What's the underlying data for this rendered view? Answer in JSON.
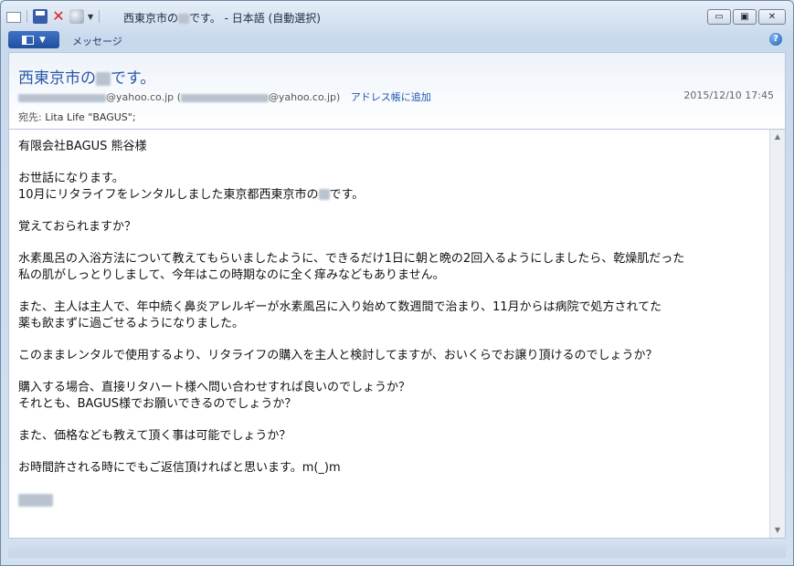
{
  "window": {
    "title_prefix": "西東京市の",
    "title_suffix": "です。 - 日本語 (自動選択)",
    "controls": {
      "minimize": "▭",
      "maximize": "▣",
      "close": "✕"
    }
  },
  "ribbon": {
    "tab_message": "メッセージ",
    "help": "?"
  },
  "header": {
    "subject_prefix": "西東京市の",
    "subject_suffix": "です。",
    "sender_domain": "@yahoo.co.jp",
    "sender_paren_open": "(",
    "sender_paren_domain": "@yahoo.co.jp)",
    "add_to_address_book": "アドレス帳に追加",
    "date": "2015/12/10 17:45",
    "to_label": "宛先:",
    "to_value": "Lita Life \"BAGUS\";"
  },
  "body": {
    "greeting": "有限会社BAGUS 熊谷様",
    "p1_line1": "お世話になります。",
    "p1_line2_prefix": "10月にリタライフをレンタルしました東京都西東京市の",
    "p1_line2_suffix": "です。",
    "p2": "覚えておられますか？",
    "p3_line1": "水素風呂の入浴方法について教えてもらいましたように、できるだけ1日に朝と晩の2回入るようにしましたら、乾燥肌だった",
    "p3_line2": "私の肌がしっとりしまして、今年はこの時期なのに全く痒みなどもありません。",
    "p4_line1": "また、主人は主人で、年中続く鼻炎アレルギーが水素風呂に入り始めて数週間で治まり、11月からは病院で処方されてた",
    "p4_line2": "薬も飲まずに過ごせるようになりました。",
    "p5": "このままレンタルで使用するより、リタライフの購入を主人と検討してますが、おいくらでお譲り頂けるのでしょうか？",
    "p6_line1": "購入する場合、直接リタハート様へ問い合わせすれば良いのでしょうか？",
    "p6_line2": "それとも、BAGUS様でお願いできるのでしょうか？",
    "p7": "また、価格なども教えて頂く事は可能でしょうか？",
    "p8": "お時間許される時にでもご返信頂ければと思います。m(_)m"
  },
  "colors": {
    "subject": "#2a5aa8",
    "link": "#1f57b0",
    "ribbon_button": "#2a5cad"
  }
}
